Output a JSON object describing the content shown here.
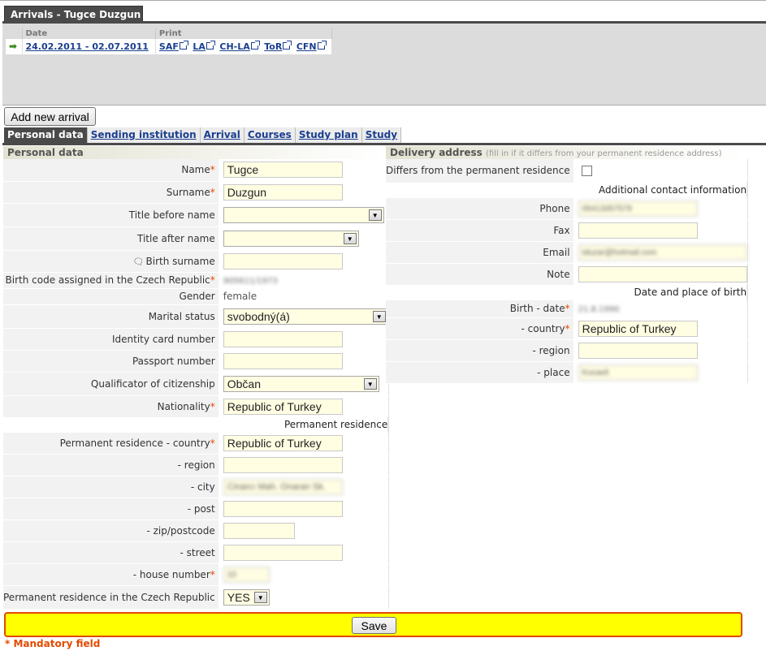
{
  "arrivals": {
    "title": "Arrivals - Tugce Duzgun",
    "table": {
      "col_date": "Date",
      "col_print": "Print",
      "row": {
        "date": "24.02.2011 - 02.07.2011",
        "print_links": [
          "SAF",
          "LA",
          "CH-LA",
          "ToR",
          "CFN"
        ]
      }
    },
    "add_button": "Add new arrival"
  },
  "tabs": [
    {
      "label": "Personal data",
      "active": true
    },
    {
      "label": "Sending institution",
      "active": false
    },
    {
      "label": "Arrival",
      "active": false
    },
    {
      "label": "Courses",
      "active": false
    },
    {
      "label": "Study plan",
      "active": false
    },
    {
      "label": "Study",
      "active": false
    }
  ],
  "personal": {
    "header": "Personal data",
    "name_label": "Name",
    "name": "Tugce",
    "surname_label": "Surname",
    "surname": "Duzgun",
    "title_before_label": "Title before name",
    "title_before": "",
    "title_after_label": "Title after name",
    "title_after": "",
    "birth_surname_label": "Birth surname",
    "birth_surname": "",
    "birth_code_label": "Birth code assigned in the Czech Republic",
    "birth_code": "905611/1973",
    "gender_label": "Gender",
    "gender": "female",
    "marital_label": "Marital status",
    "marital": "svobodný(á)",
    "id_card_label": "Identity card number",
    "id_card": "",
    "passport_label": "Passport number",
    "passport": "",
    "citizenship_label": "Qualificator of citizenship",
    "citizenship": "Občan",
    "nationality_label": "Nationality",
    "nationality": "Republic of Turkey",
    "perm_section": "Permanent residence",
    "perm_country_label": "Permanent residence - country",
    "perm_country": "Republic of Turkey",
    "perm_region_label": "- region",
    "perm_region": "",
    "perm_city_label": "- city",
    "perm_city": "Cinarcı Mah. Onaran Sk.",
    "perm_post_label": "- post",
    "perm_post": "",
    "perm_zip_label": "- zip/postcode",
    "perm_zip": "",
    "perm_street_label": "- street",
    "perm_street": "",
    "perm_house_label": "- house number",
    "perm_house": "10",
    "perm_cz_label": "Permanent residence in the Czech Republic",
    "perm_cz": "YES"
  },
  "delivery": {
    "header": "Delivery address",
    "hint": "(fill in if it differs from your permanent residence address)",
    "differs_label": "Differs from the permanent residence",
    "contact_section": "Additional contact information",
    "phone_label": "Phone",
    "phone": "05413357579",
    "fax_label": "Fax",
    "fax": "",
    "email_label": "Email",
    "email": "tduzar@hotmail.com",
    "note_label": "Note",
    "note": "",
    "birth_section": "Date and place of birth",
    "birth_date_label": "Birth - date",
    "birth_date": "21.8.1990",
    "birth_country_label": "- country",
    "birth_country": "Republic of Turkey",
    "birth_region_label": "- region",
    "birth_region": "",
    "birth_place_label": "- place",
    "birth_place": "Kocaeli"
  },
  "footer": {
    "save_label": "Save",
    "mandatory_note": "* Mandatory field"
  },
  "req_mark": "*"
}
